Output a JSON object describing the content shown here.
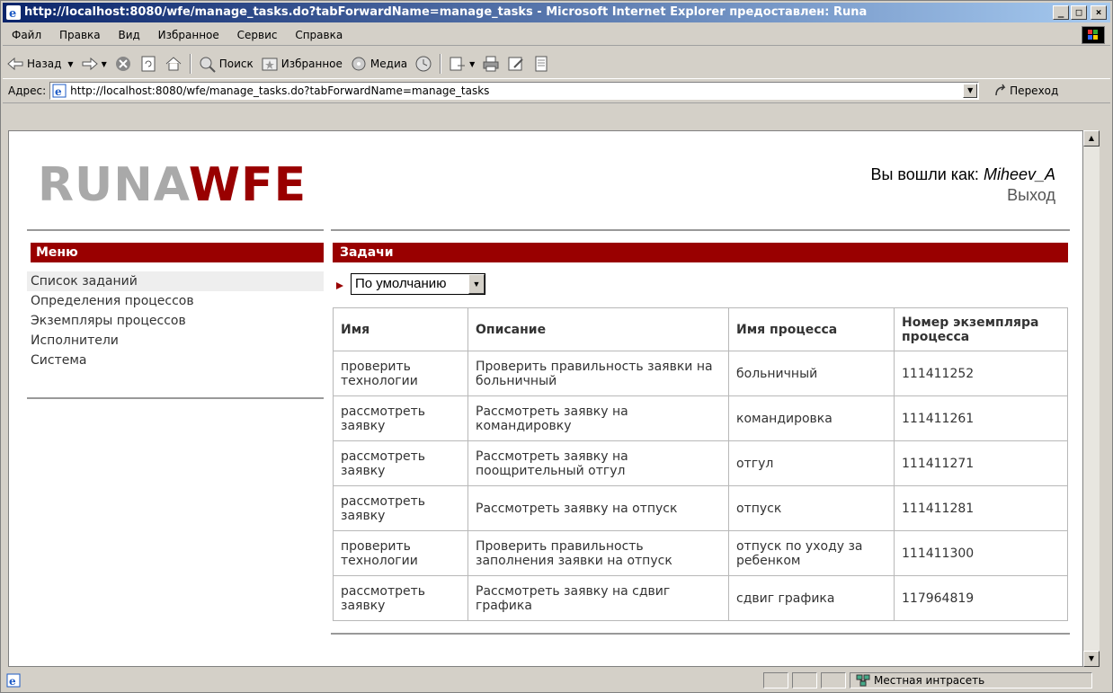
{
  "window": {
    "title": "http://localhost:8080/wfe/manage_tasks.do?tabForwardName=manage_tasks - Microsoft Internet Explorer предоставлен: Runa",
    "minimize": "_",
    "maximize": "□",
    "close": "×"
  },
  "menubar": [
    "Файл",
    "Правка",
    "Вид",
    "Избранное",
    "Сервис",
    "Справка"
  ],
  "toolbar": {
    "back": "Назад",
    "search": "Поиск",
    "favorites": "Избранное",
    "media": "Медиа"
  },
  "address": {
    "label": "Адрес:",
    "url": "http://localhost:8080/wfe/manage_tasks.do?tabForwardName=manage_tasks",
    "go": "Переход"
  },
  "page": {
    "logo": {
      "part1": "RUNA",
      "part2": "WFE"
    },
    "login_prefix": "Вы вошли как:",
    "login_user": "Miheev_A",
    "logout": "Выход",
    "menu_title": "Меню",
    "menu_items": [
      "Список заданий",
      "Определения процессов",
      "Экземпляры процессов",
      "Исполнители",
      "Система"
    ],
    "tasks_title": "Задачи",
    "filter_value": "По умолчанию",
    "table": {
      "headers": [
        "Имя",
        "Описание",
        "Имя процесса",
        "Номер экземпляра процесса"
      ],
      "rows": [
        [
          "проверить технологии",
          "Проверить правильность заявки на больничный",
          "больничный",
          "111411252"
        ],
        [
          "рассмотреть заявку",
          "Рассмотреть заявку на командировку",
          "командировка",
          "111411261"
        ],
        [
          "рассмотреть заявку",
          "Рассмотреть заявку на поощрительный отгул",
          "отгул",
          "111411271"
        ],
        [
          "рассмотреть заявку",
          "Рассмотреть заявку на отпуск",
          "отпуск",
          "111411281"
        ],
        [
          "проверить технологии",
          "Проверить правильность заполнения заявки на отпуск",
          "отпуск по уходу за ребенком",
          "111411300"
        ],
        [
          "рассмотреть заявку",
          "Рассмотреть заявку на сдвиг графика",
          "сдвиг графика",
          "117964819"
        ]
      ]
    }
  },
  "status": {
    "zone": "Местная интрасеть"
  },
  "colors": {
    "accent": "#990000",
    "titlebar": "#0a246a"
  }
}
